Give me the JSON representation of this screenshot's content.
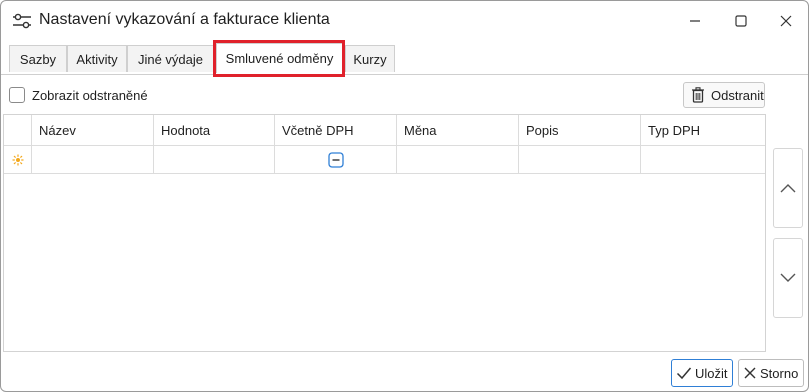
{
  "window": {
    "title": "Nastavení vykazování a fakturace klienta"
  },
  "title_controls": {
    "minimize": "—",
    "maximize": "☐",
    "close": "✕"
  },
  "tabs": [
    {
      "label": "Sazby",
      "active": false
    },
    {
      "label": "Aktivity",
      "active": false
    },
    {
      "label": "Jiné výdaje",
      "active": false
    },
    {
      "label": "Smluvené odměny",
      "active": true
    },
    {
      "label": "Kurzy",
      "active": false
    }
  ],
  "toolbar": {
    "show_deleted_label": "Zobrazit odstraněné",
    "show_deleted_checked": false,
    "delete_label": "Odstranit"
  },
  "grid": {
    "columns": [
      "Název",
      "Hodnota",
      "Včetně DPH",
      "Měna",
      "Popis",
      "Typ DPH"
    ],
    "new_row": {
      "indicator_icon": "asterisk-new-row-icon",
      "vat_included_checked": "indeterminate"
    }
  },
  "side_buttons": {
    "up_icon": "chevron-up-icon",
    "down_icon": "chevron-down-icon"
  },
  "footer": {
    "save_label": "Uložit",
    "cancel_label": "Storno"
  },
  "colors": {
    "highlight": "#e0212b",
    "accent": "#2f7fd6"
  }
}
